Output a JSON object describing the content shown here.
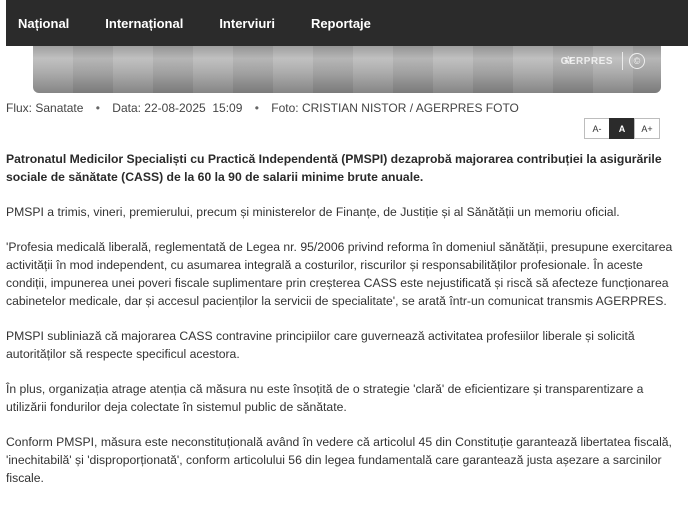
{
  "nav": {
    "items": [
      "Național",
      "Internațional",
      "Interviuri",
      "Reportaje"
    ]
  },
  "hero": {
    "watermark": "GERPRES",
    "copyright": "©"
  },
  "meta": {
    "flux": "Flux: Sanatate",
    "date": "Data: 22-08-2025  15:09",
    "photo": "Foto: CRISTIAN NISTOR / AGERPRES FOTO"
  },
  "fontsize": {
    "smaller": "A-",
    "normal": "A",
    "larger": "A+"
  },
  "article": {
    "lead": "Patronatul Medicilor Specialiști cu Practică Independentă (PMSPI) dezaprobă majorarea contribuției la asigurările sociale de sănătate (CASS) de la 60 la 90 de salarii minime brute anuale.",
    "paragraphs": [
      "PMSPI a trimis, vineri, premierului, precum și ministerelor de Finanțe, de Justiție și al Sănătății un memoriu oficial.",
      "'Profesia medicală liberală, reglementată de Legea nr. 95/2006 privind reforma în domeniul sănătății, presupune exercitarea activității în mod independent, cu asumarea integrală a costurilor, riscurilor și responsabilităților profesionale. În aceste condiții, impunerea unei poveri fiscale suplimentare prin creșterea CASS este nejustificată și riscă să afecteze funcționarea cabinetelor medicale, dar și accesul pacienților la servicii de specialitate', se arată într-un comunicat transmis AGERPRES.",
      "PMSPI subliniază că majorarea CASS contravine principiilor care guvernează activitatea profesiilor liberale și solicită autorităților să respecte specificul acestora.",
      "În plus, organizația atrage atenția că măsura nu este însoțită de o strategie 'clară' de eficientizare și transparentizare a utilizării fondurilor deja colectate în sistemul public de sănătate.",
      "Conform PMSPI, măsura este neconstituțională având în vedere că articolul 45 din Constituție garantează libertatea fiscală, 'inechitabilă' și 'disproporționată', conform articolului 56 din legea fundamentală care garantează justa așezare a sarcinilor fiscale."
    ]
  }
}
